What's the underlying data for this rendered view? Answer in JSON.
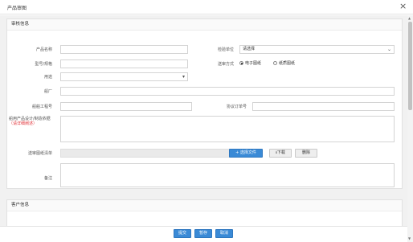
{
  "dialog": {
    "title": "产品审图",
    "close_icon": "close-icon"
  },
  "audit": {
    "section_title": "审核信息",
    "product_name": {
      "label": "产品名称",
      "value": ""
    },
    "inspection_unit": {
      "label": "检验单位",
      "value": "请选择"
    },
    "model_spec": {
      "label": "型号/规格",
      "value": ""
    },
    "submit_method": {
      "label": "送审方式",
      "options": [
        "电子图纸",
        "纸质图纸"
      ],
      "selected": "电子图纸"
    },
    "purpose": {
      "label": "用途",
      "value": ""
    },
    "shipyard": {
      "label": "船厂",
      "value": ""
    },
    "hull_no": {
      "label": "船舶工程号",
      "value": ""
    },
    "contract_no": {
      "label": "协议订单号",
      "value": ""
    },
    "design_doc": {
      "label": "船用产品设计/制造依据",
      "hint": "（请详细阐述）",
      "value": ""
    },
    "drawing_list": {
      "label": "送审图纸清单",
      "select_file": "选择文件",
      "download": "下载",
      "delete": "删除"
    },
    "remarks": {
      "label": "备注",
      "value": ""
    }
  },
  "customer": {
    "section_title": "客户信息"
  },
  "footer": {
    "submit": "提交",
    "save": "暂存",
    "cancel": "取消"
  },
  "colors": {
    "primary": "#3a8ad6",
    "required": "#e2363c"
  }
}
